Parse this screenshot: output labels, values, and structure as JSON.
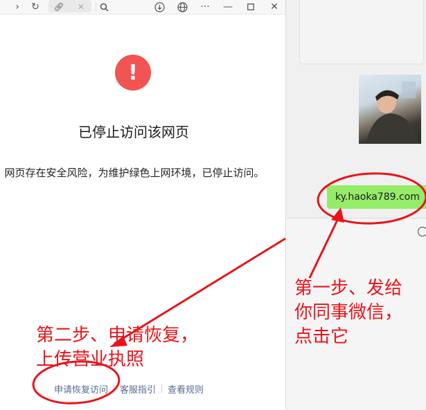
{
  "toolbar": {
    "icons": [
      "forward-icon",
      "refresh-icon",
      "link-icon",
      "close-icon",
      "search-icon",
      "download-icon",
      "globe-icon",
      "more-icon",
      "minimize-icon",
      "maximize-icon",
      "window-close-icon"
    ]
  },
  "page": {
    "warning_symbol": "!",
    "title": "已停止访问该网页",
    "description": "网页存在安全风险，为维护绿色上网环境，已停止访问。",
    "footer_links": [
      "申请恢复访问",
      "客服指引",
      "查看规则"
    ]
  },
  "chat": {
    "message": "ky.haoka789.com"
  },
  "annotations": {
    "step1": [
      "第一步、发给",
      "你同事微信，",
      "点击它"
    ],
    "step2": [
      "第二步、申请恢复，",
      "上传营业执照"
    ]
  },
  "colors": {
    "warning": "#f25454",
    "bubble": "#95ec69",
    "annotation": "#e8141a",
    "link": "#576b95"
  }
}
